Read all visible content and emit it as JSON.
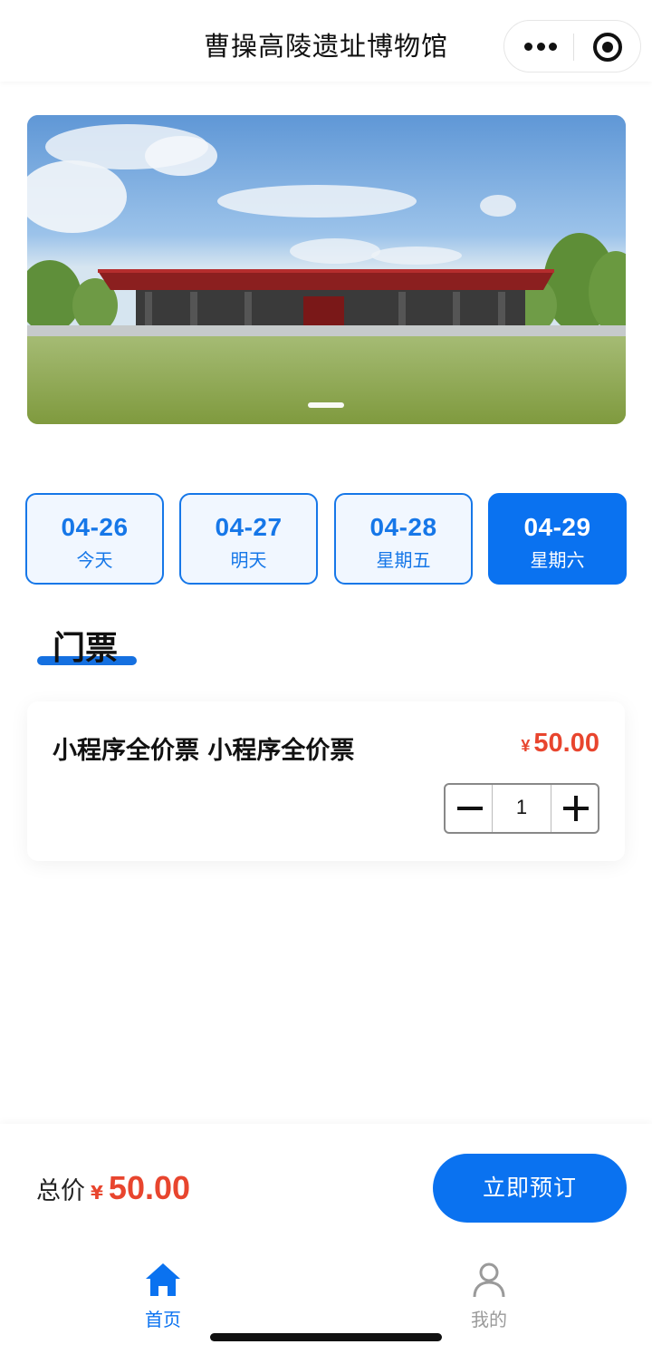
{
  "navbar": {
    "title": "曹操高陵遗址博物馆"
  },
  "banner": {
    "slide_count": 1,
    "active_slide": 1
  },
  "dates": [
    {
      "date": "04-26",
      "weekday": "今天",
      "selected": false
    },
    {
      "date": "04-27",
      "weekday": "明天",
      "selected": false
    },
    {
      "date": "04-28",
      "weekday": "星期五",
      "selected": false
    },
    {
      "date": "04-29",
      "weekday": "星期六",
      "selected": true
    }
  ],
  "section": {
    "title": "门票"
  },
  "ticket": {
    "name": "小程序全价票 小程序全价票",
    "currency": "¥",
    "price": "50.00",
    "quantity": "1"
  },
  "footer": {
    "total_label": "总价",
    "currency": "¥",
    "total": "50.00",
    "book_button": "立即预订"
  },
  "tabbar": {
    "home_label": "首页",
    "mine_label": "我的"
  },
  "colors": {
    "accent": "#0a72f0",
    "price": "#e8452e"
  }
}
